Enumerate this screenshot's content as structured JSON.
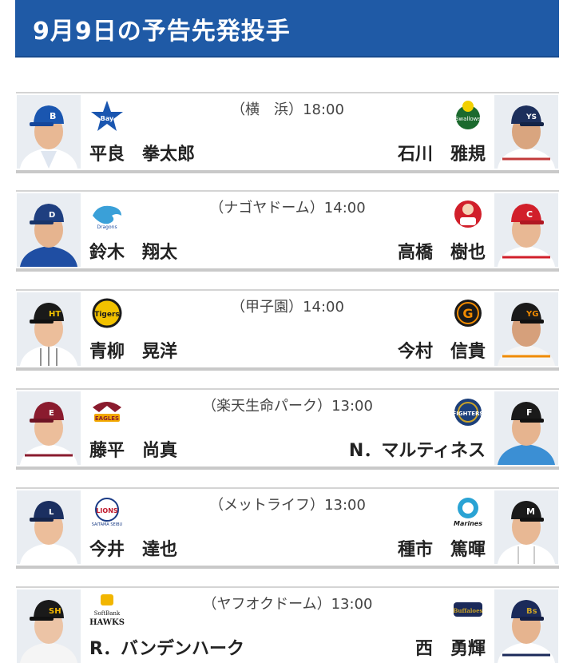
{
  "header": {
    "title": "9月9日の予告先発投手"
  },
  "games": [
    {
      "venue": "（横　浜）",
      "time": "18:00",
      "home": {
        "pitcher": "平良　拳太郎",
        "team_logo": "baystars-logo",
        "accent": "#1a56b0"
      },
      "away": {
        "pitcher": "石川　雅規",
        "team_logo": "swallows-logo",
        "accent": "#1b6a2e"
      }
    },
    {
      "venue": "（ナゴヤドーム）",
      "time": "14:00",
      "home": {
        "pitcher": "鈴木　翔太",
        "team_logo": "dragons-logo",
        "accent": "#1f4ea3"
      },
      "away": {
        "pitcher": "高橋　樹也",
        "team_logo": "carp-logo",
        "accent": "#d11f2a"
      }
    },
    {
      "venue": "（甲子園）",
      "time": "14:00",
      "home": {
        "pitcher": "青柳　晃洋",
        "team_logo": "tigers-logo",
        "accent": "#f2c200"
      },
      "away": {
        "pitcher": "今村　信貴",
        "team_logo": "giants-logo",
        "accent": "#f08a00"
      }
    },
    {
      "venue": "（楽天生命パーク）",
      "time": "13:00",
      "home": {
        "pitcher": "藤平　尚真",
        "team_logo": "eagles-logo",
        "accent": "#8a1b2e"
      },
      "away": {
        "pitcher": "N．マルティネス",
        "team_logo": "fighters-logo",
        "accent": "#1c3f7a"
      }
    },
    {
      "venue": "（メットライフ）",
      "time": "13:00",
      "home": {
        "pitcher": "今井　達也",
        "team_logo": "lions-logo",
        "accent": "#1b3c86"
      },
      "away": {
        "pitcher": "種市　篤暉",
        "team_logo": "marines-logo",
        "accent": "#1a1a1a"
      }
    },
    {
      "venue": "（ヤフオクドーム）",
      "time": "13:00",
      "home": {
        "pitcher": "R．バンデンハーク",
        "team_logo": "hawks-logo",
        "accent": "#f2b600"
      },
      "away": {
        "pitcher": "西　勇輝",
        "team_logo": "buffaloes-logo",
        "accent": "#1b2a5a"
      }
    }
  ]
}
